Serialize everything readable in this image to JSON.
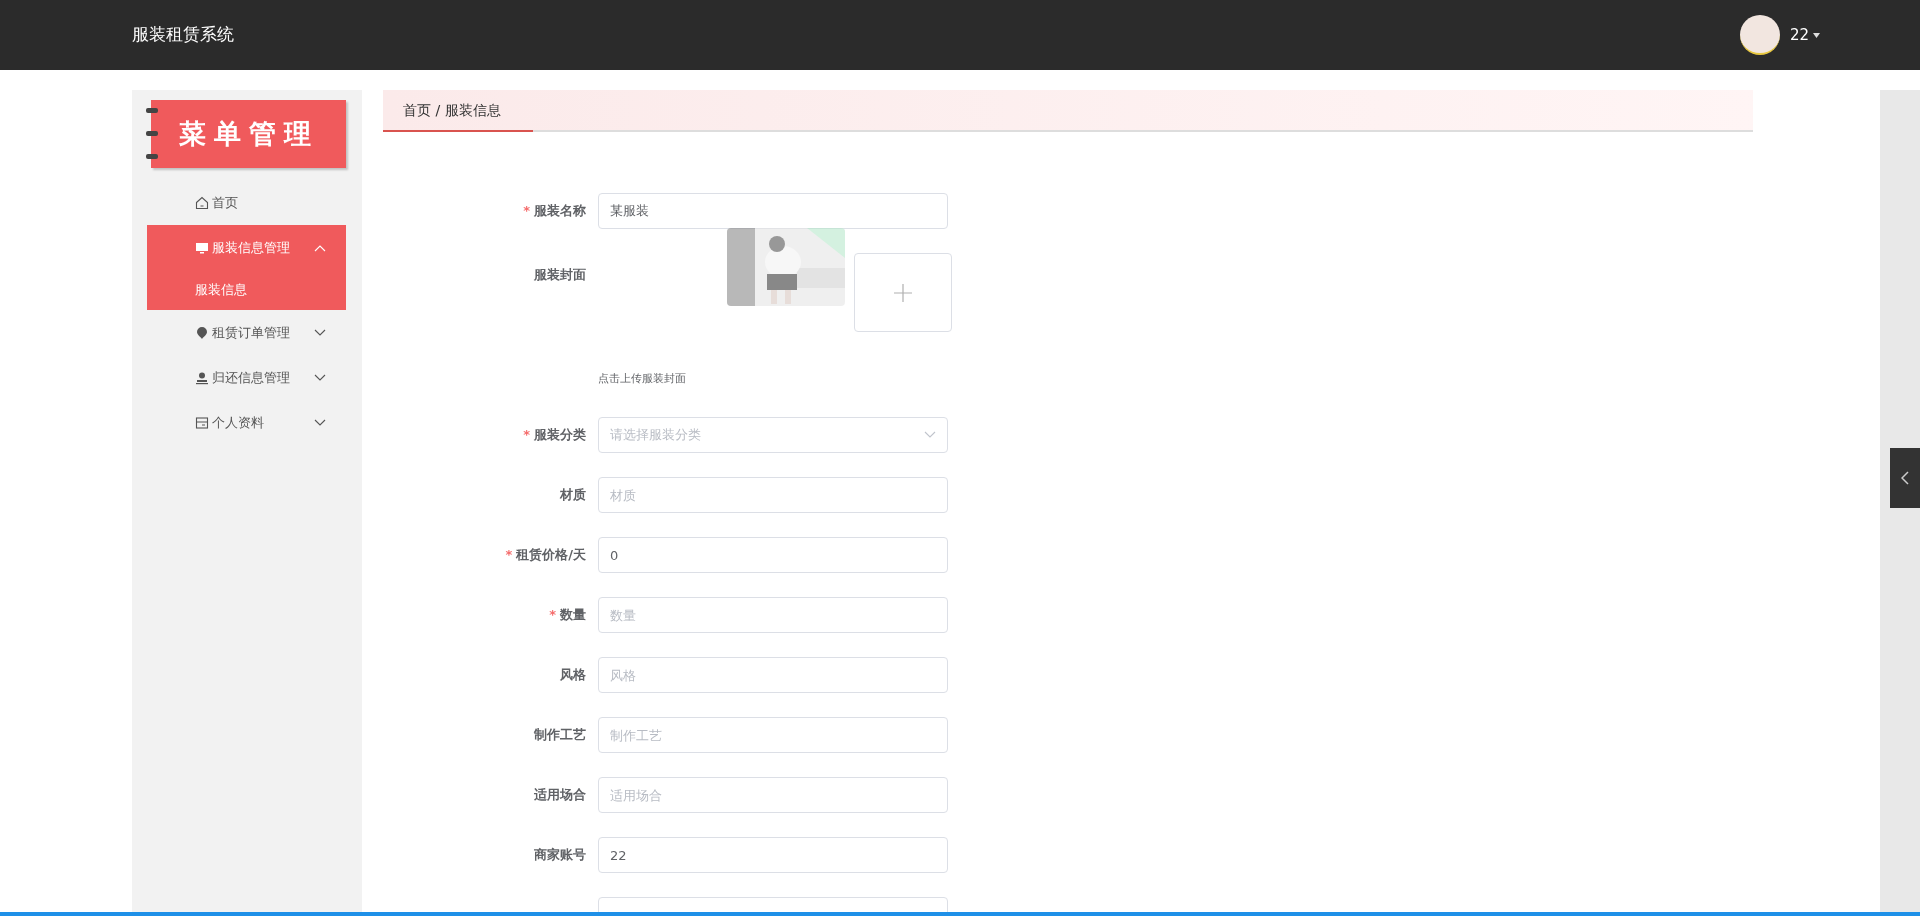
{
  "header": {
    "title": "服装租赁系统",
    "user": "22"
  },
  "sidebar": {
    "banner": "菜单管理",
    "items": [
      {
        "kind": "link",
        "label": "首页",
        "selected": false
      },
      {
        "kind": "group",
        "label": "服装信息管理",
        "selected": true,
        "expanded": true,
        "children": [
          {
            "label": "服装信息",
            "selected": true
          }
        ]
      },
      {
        "kind": "group",
        "label": "租赁订单管理",
        "selected": false,
        "expanded": false
      },
      {
        "kind": "group",
        "label": "归还信息管理",
        "selected": false,
        "expanded": false
      },
      {
        "kind": "group",
        "label": "个人资料",
        "selected": false,
        "expanded": false
      }
    ]
  },
  "breadcrumb": "首页 / 服装信息",
  "form": {
    "fields": [
      {
        "kind": "text",
        "label": "服装名称",
        "marker": "*",
        "value": "某服装"
      },
      {
        "kind": "upload",
        "label": "服装封面",
        "hint": "点击上传服装封面"
      },
      {
        "kind": "select",
        "label": "服装分类",
        "marker": "*",
        "placeholder": "请选择服装分类"
      },
      {
        "kind": "text",
        "label": "材质",
        "placeholder": "材质"
      },
      {
        "kind": "text",
        "label": "租赁价格/天",
        "marker": "*",
        "value": "0"
      },
      {
        "kind": "text",
        "label": "数量",
        "marker": "*",
        "placeholder": "数量"
      },
      {
        "kind": "text",
        "label": "风格",
        "placeholder": "风格"
      },
      {
        "kind": "text",
        "label": "制作工艺",
        "placeholder": "制作工艺"
      },
      {
        "kind": "text",
        "label": "适用场合",
        "placeholder": "适用场合"
      },
      {
        "kind": "text",
        "label": "商家账号",
        "value": "22"
      },
      {
        "kind": "cut"
      }
    ]
  }
}
